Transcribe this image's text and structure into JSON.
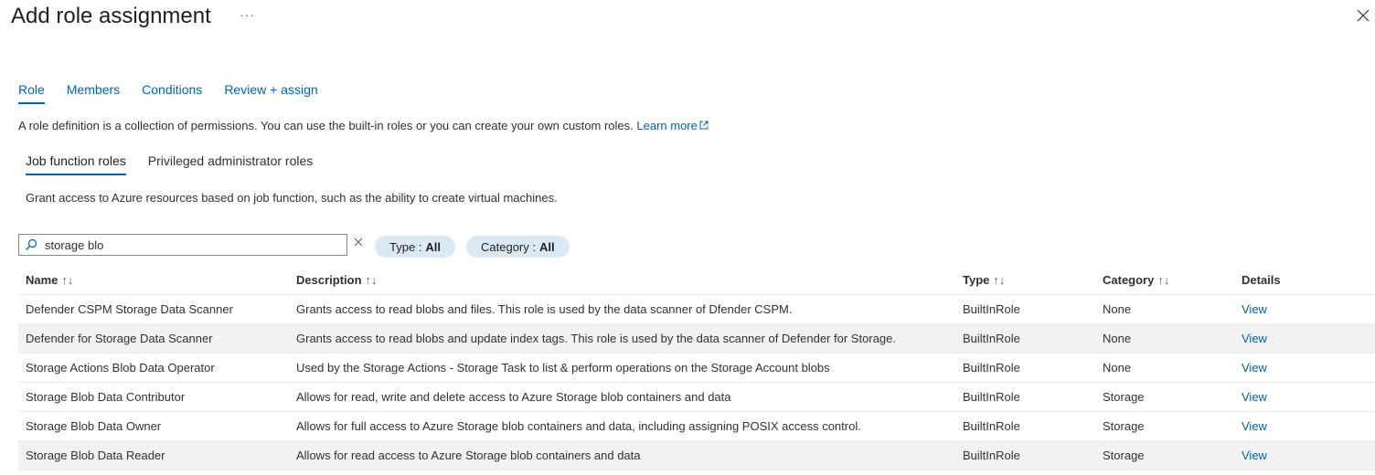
{
  "header": {
    "title": "Add role assignment",
    "more_label": "···"
  },
  "tabs": [
    {
      "label": "Role"
    },
    {
      "label": "Members"
    },
    {
      "label": "Conditions"
    },
    {
      "label": "Review + assign"
    }
  ],
  "intro": {
    "text": "A role definition is a collection of permissions. You can use the built-in roles or you can create your own custom roles.",
    "link": "Learn more"
  },
  "subtabs": [
    {
      "label": "Job function roles"
    },
    {
      "label": "Privileged administrator roles"
    }
  ],
  "subdesc": "Grant access to Azure resources based on job function, such as the ability to create virtual machines.",
  "search": {
    "value": "storage blo"
  },
  "filters": {
    "type": {
      "label": "Type :",
      "value": "All"
    },
    "category": {
      "label": "Category :",
      "value": "All"
    }
  },
  "table": {
    "headers": {
      "name": "Name",
      "description": "Description",
      "type": "Type",
      "category": "Category",
      "details": "Details"
    },
    "rows": [
      {
        "name": "Defender CSPM Storage Data Scanner",
        "description": "Grants access to read blobs and files. This role is used by the data scanner of Dfender CSPM.",
        "type": "BuiltInRole",
        "category": "None",
        "details": "View"
      },
      {
        "name": "Defender for Storage Data Scanner",
        "description": "Grants access to read blobs and update index tags. This role is used by the data scanner of Defender for Storage.",
        "type": "BuiltInRole",
        "category": "None",
        "details": "View"
      },
      {
        "name": "Storage Actions Blob Data Operator",
        "description": "Used by the Storage Actions - Storage Task to list & perform operations on the Storage Account blobs",
        "type": "BuiltInRole",
        "category": "None",
        "details": "View"
      },
      {
        "name": "Storage Blob Data Contributor",
        "description": "Allows for read, write and delete access to Azure Storage blob containers and data",
        "type": "BuiltInRole",
        "category": "Storage",
        "details": "View"
      },
      {
        "name": "Storage Blob Data Owner",
        "description": "Allows for full access to Azure Storage blob containers and data, including assigning POSIX access control.",
        "type": "BuiltInRole",
        "category": "Storage",
        "details": "View"
      },
      {
        "name": "Storage Blob Data Reader",
        "description": "Allows for read access to Azure Storage blob containers and data",
        "type": "BuiltInRole",
        "category": "Storage",
        "details": "View"
      }
    ]
  },
  "icons": {
    "close": "close-icon",
    "search": "search-icon",
    "clear": "clear-icon",
    "external": "external-link-icon",
    "sort": "sort-icon"
  },
  "colors": {
    "accent": "#0064b4",
    "pill_bg": "#dbe9f6",
    "row_highlight": "#f3f2f1"
  }
}
